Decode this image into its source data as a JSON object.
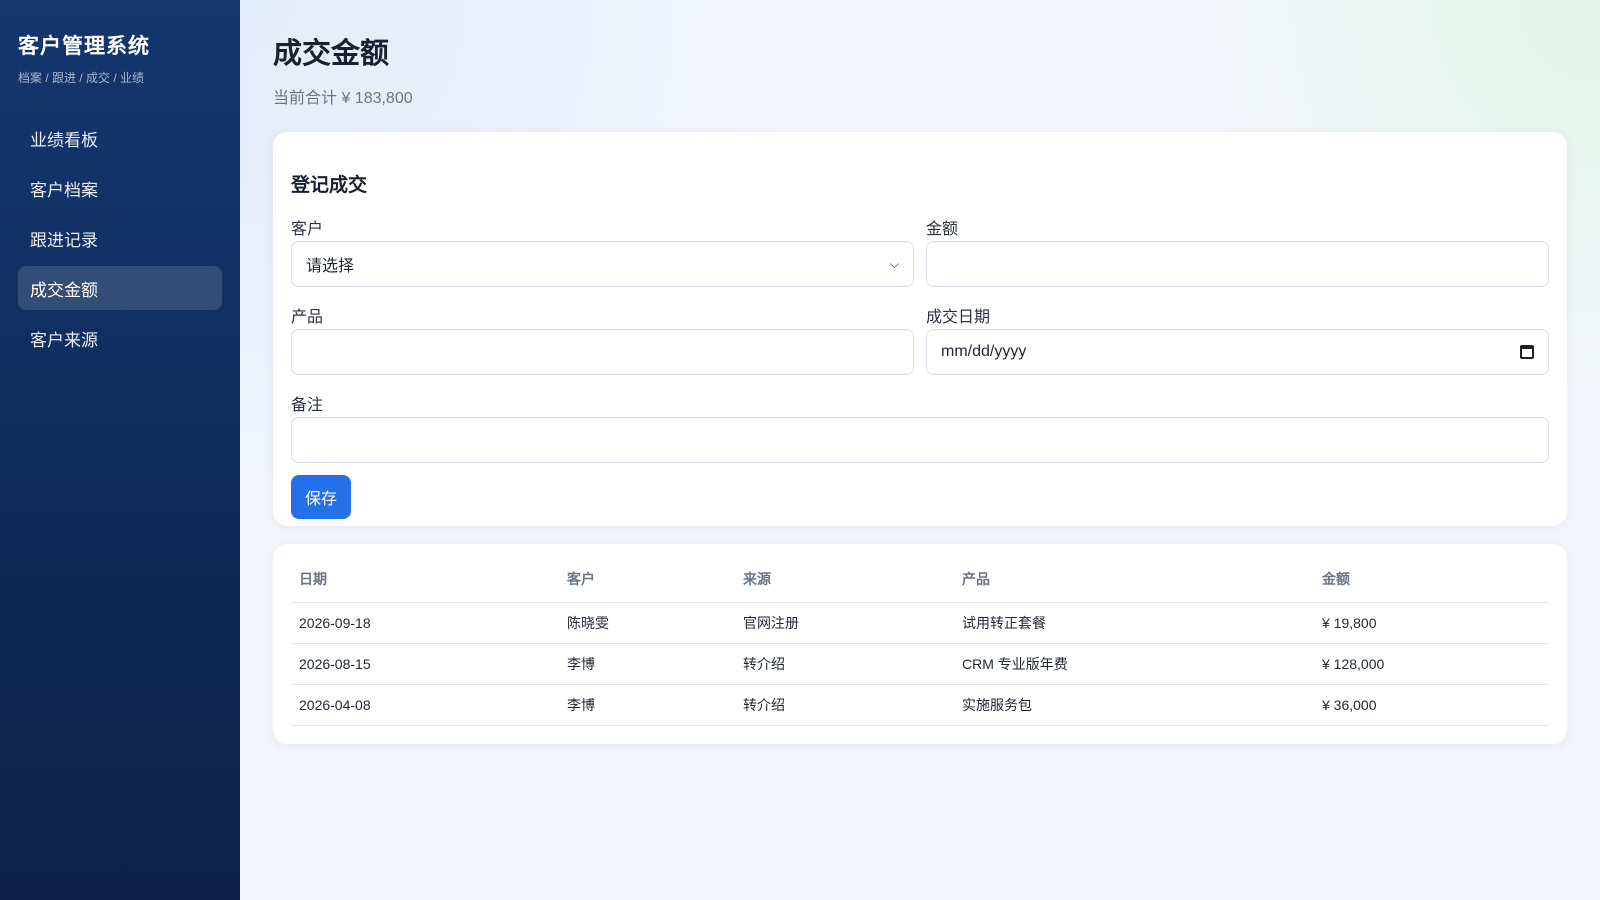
{
  "sidebar": {
    "brand_title": "客户管理系统",
    "brand_sub": "档案 / 跟进 / 成交 / 业绩",
    "items": [
      {
        "label": "业绩看板",
        "active": false
      },
      {
        "label": "客户档案",
        "active": false
      },
      {
        "label": "跟进记录",
        "active": false
      },
      {
        "label": "成交金额",
        "active": true
      },
      {
        "label": "客户来源",
        "active": false
      }
    ]
  },
  "header": {
    "title": "成交金额",
    "subtitle": "当前合计 ¥ 183,800"
  },
  "form": {
    "title": "登记成交",
    "customer": {
      "label": "客户",
      "value": "请选择"
    },
    "amount": {
      "label": "金额",
      "value": ""
    },
    "product": {
      "label": "产品",
      "value": ""
    },
    "date": {
      "label": "成交日期",
      "value": "mm/dd/yyyy"
    },
    "note": {
      "label": "备注",
      "value": ""
    },
    "save_label": "保存"
  },
  "table": {
    "headers": [
      "日期",
      "客户",
      "来源",
      "产品",
      "金额"
    ],
    "rows": [
      [
        "2026-09-18",
        "陈晓雯",
        "官网注册",
        "试用转正套餐",
        "¥ 19,800"
      ],
      [
        "2026-08-15",
        "李博",
        "转介绍",
        "CRM 专业版年费",
        "¥ 128,000"
      ],
      [
        "2026-04-08",
        "李博",
        "转介绍",
        "实施服务包",
        "¥ 36,000"
      ]
    ]
  },
  "colors": {
    "sidebar": "#102c5c",
    "accent": "#2470e6",
    "background": "#f2f5fa"
  }
}
